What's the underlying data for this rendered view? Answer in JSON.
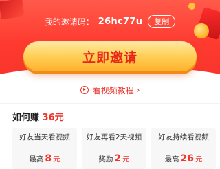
{
  "invite": {
    "label": "我的邀请码：",
    "code": "26hc77u",
    "copy_label": "复制"
  },
  "cta": {
    "label": "立即邀请"
  },
  "video_link": {
    "label": "看视频教程"
  },
  "earn": {
    "title": "如何赚",
    "amount": "36元"
  },
  "cards": [
    {
      "label": "好友当天看视频",
      "prefix": "最高",
      "value": "8",
      "unit": "元"
    },
    {
      "label": "好友再看2天视频",
      "prefix": "奖励",
      "value": "2",
      "unit": "元"
    },
    {
      "label": "好友持续看视频",
      "prefix": "最高",
      "value": "26",
      "unit": "元"
    }
  ],
  "colors": {
    "banner": "#ff3b30",
    "accent": "#f0332b",
    "cta": "#ffd25c"
  }
}
